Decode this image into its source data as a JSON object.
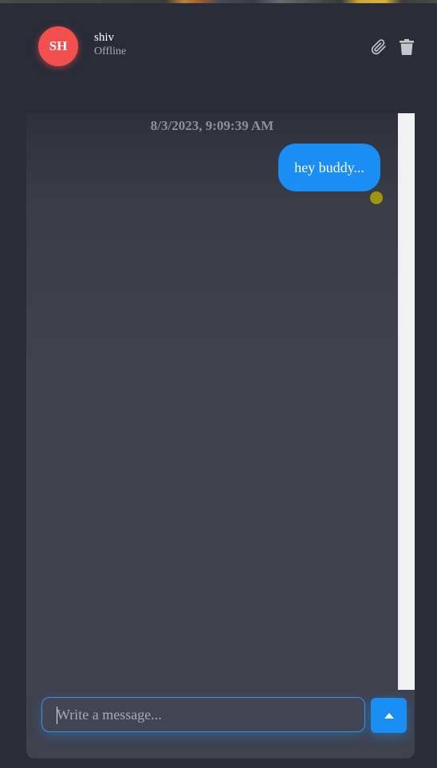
{
  "contact": {
    "initials": "SH",
    "name": "shiv",
    "status": "Offline",
    "avatar_color": "#f24f4f"
  },
  "header_actions": {
    "attach_icon": "paperclip-icon",
    "delete_icon": "trash-icon"
  },
  "conversation": {
    "date_label": "8/3/2023, 9:09:39 AM",
    "messages": [
      {
        "direction": "outgoing",
        "text": "hey buddy...",
        "bubble_color": "#1b8ef5",
        "status_dot_color": "#a0950f"
      }
    ]
  },
  "composer": {
    "value": "",
    "placeholder": "Write a message...",
    "send_icon": "caret-up-icon",
    "accent": "#1b8ef5"
  }
}
